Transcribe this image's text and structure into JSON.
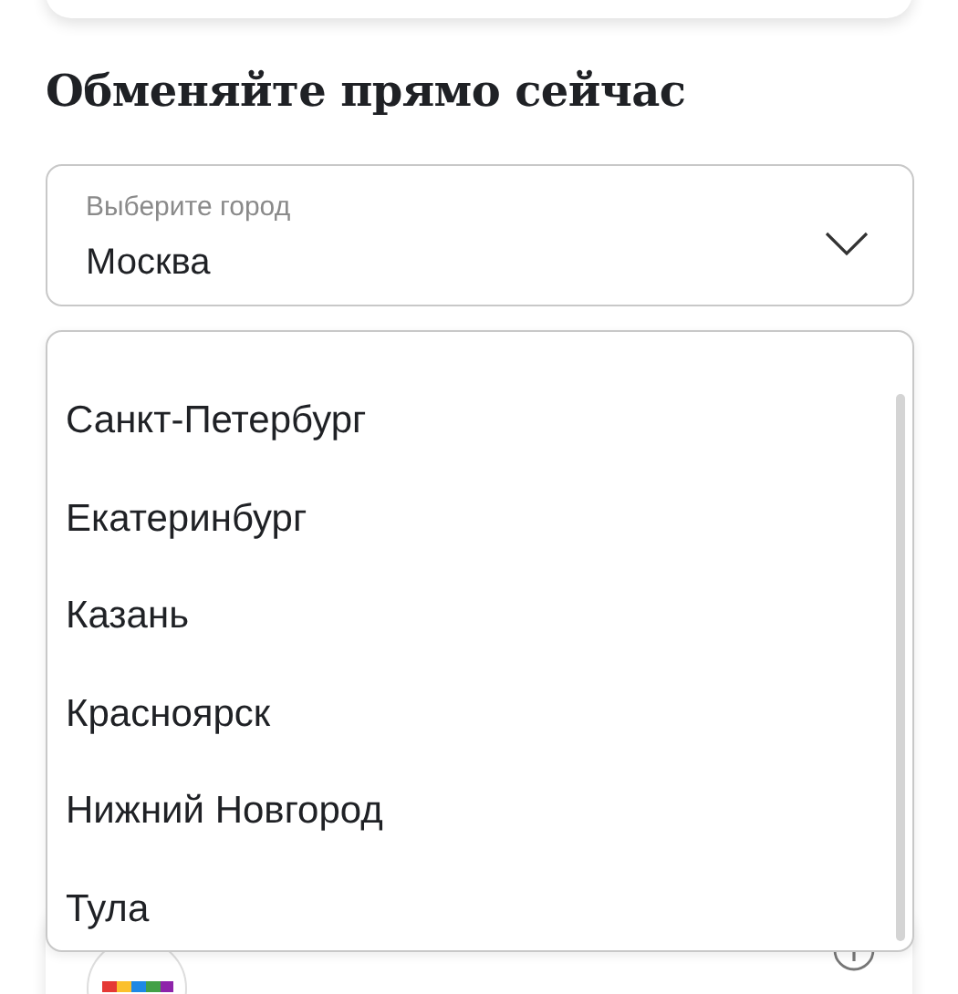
{
  "heading": "Обменяйте прямо сейчас",
  "city_select": {
    "label": "Выберите город",
    "value": "Москва"
  },
  "city_options": [
    {
      "label": "Санкт-Петербург",
      "selected": false
    },
    {
      "label": "Екатеринбург",
      "selected": false
    },
    {
      "label": "Казань",
      "selected": false
    },
    {
      "label": "Красноярск",
      "selected": false
    },
    {
      "label": "Нижний Новгород",
      "selected": false
    },
    {
      "label": "Тула",
      "selected": false
    }
  ]
}
